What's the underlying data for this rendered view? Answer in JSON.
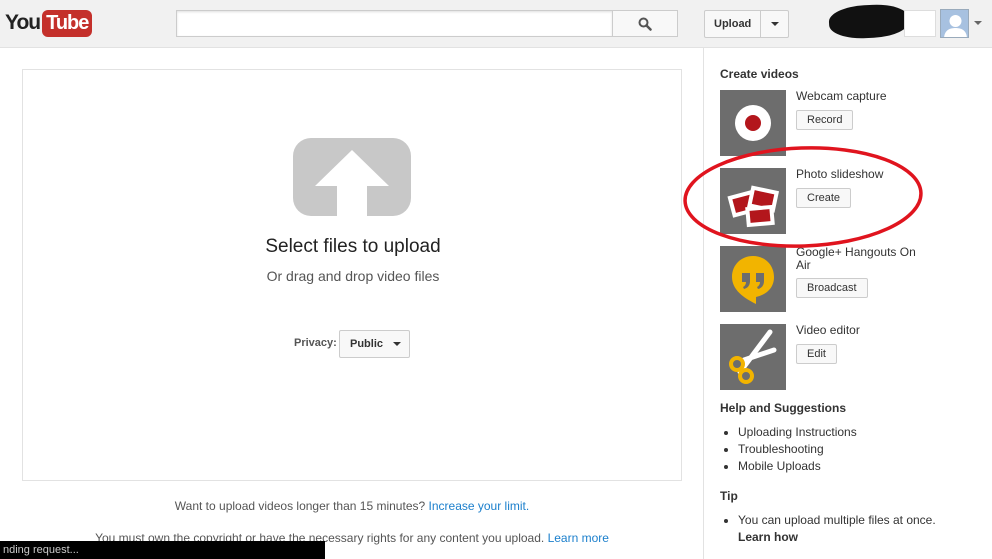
{
  "header": {
    "logo_you": "You",
    "logo_tube": "Tube",
    "search": {
      "value": "",
      "placeholder": ""
    },
    "search_icon": "search-icon",
    "upload_label": "Upload"
  },
  "upload": {
    "title": "Select files to upload",
    "subtitle": "Or drag and drop video files",
    "privacy_label": "Privacy:",
    "privacy_value": "Public",
    "longer_text": "Want to upload videos longer than 15 minutes?",
    "longer_link": "Increase your limit.",
    "copyright_text": "You must own the copyright or have the necessary rights for any content you upload.",
    "copyright_link": "Learn more"
  },
  "status_bar": "nding request...",
  "sidebar": {
    "create_heading": "Create videos",
    "tools": [
      {
        "name": "Webcam capture",
        "button": "Record",
        "icon": "record-icon"
      },
      {
        "name": "Photo slideshow",
        "button": "Create",
        "icon": "photos-icon"
      },
      {
        "name": "Google+ Hangouts On Air",
        "button": "Broadcast",
        "icon": "hangouts-icon"
      },
      {
        "name": "Video editor",
        "button": "Edit",
        "icon": "scissors-icon"
      }
    ],
    "help_heading": "Help and Suggestions",
    "help_links": [
      "Uploading Instructions",
      "Troubleshooting",
      "Mobile Uploads"
    ],
    "tip_heading": "Tip",
    "tip_text": "You can upload multiple files at once.",
    "tip_link": "Learn how"
  },
  "colors": {
    "brand_red": "#c4302b",
    "link_blue": "#1b7fcc",
    "annotation_red": "#e0141e"
  }
}
